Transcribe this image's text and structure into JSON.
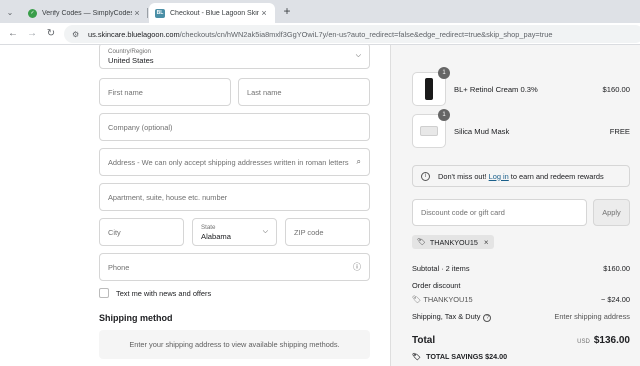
{
  "browser": {
    "tabs": [
      {
        "title": "Verify Codes — SimplyCodes",
        "active": false
      },
      {
        "title": "Checkout - Blue Lagoon Skincare",
        "active": true,
        "favicon_text": "BL"
      }
    ],
    "url_host": "us.skincare.bluelagoon.com",
    "url_path": "/checkouts/cn/hWN2ak5ia8mxlf3GgYOwiL7y/en-us?auto_redirect=false&edge_redirect=true&skip_shop_pay=true"
  },
  "form": {
    "country": {
      "label": "Country/Region",
      "value": "United States"
    },
    "first_name_placeholder": "First name",
    "last_name_placeholder": "Last name",
    "company_placeholder": "Company (optional)",
    "address_placeholder": "Address - We can only accept shipping addresses written in roman letters",
    "apartment_placeholder": "Apartment, suite, house etc. number",
    "city_placeholder": "City",
    "state": {
      "label": "State",
      "value": "Alabama"
    },
    "zip_placeholder": "ZIP code",
    "phone_placeholder": "Phone",
    "news_checkbox_label": "Text me with news and offers",
    "news_checked": false
  },
  "shipping": {
    "title": "Shipping method",
    "note": "Enter your shipping address to view available shipping methods."
  },
  "summary": {
    "items": [
      {
        "name": "BL+ Retinol Cream 0.3%",
        "price": "$160.00",
        "qty": "1",
        "thumb": "bottle"
      },
      {
        "name": "Silica Mud Mask",
        "price": "FREE",
        "qty": "1",
        "thumb": "jar"
      }
    ],
    "notice": {
      "before": "Don't miss out!",
      "link": "Log in",
      "after": "to earn and redeem rewards"
    },
    "discount_placeholder": "Discount code or gift card",
    "apply_label": "Apply",
    "applied_code": "THANKYOU15",
    "subtotal_label": "Subtotal · 2 items",
    "subtotal_value": "$160.00",
    "order_discount_label": "Order discount",
    "order_discount_code": "THANKYOU15",
    "order_discount_value": "− $24.00",
    "shipping_label": "Shipping, Tax & Duty",
    "shipping_value": "Enter shipping address",
    "total_label": "Total",
    "total_currency": "USD",
    "total_value": "$136.00",
    "savings_label": "TOTAL SAVINGS",
    "savings_value": "$24.00"
  }
}
